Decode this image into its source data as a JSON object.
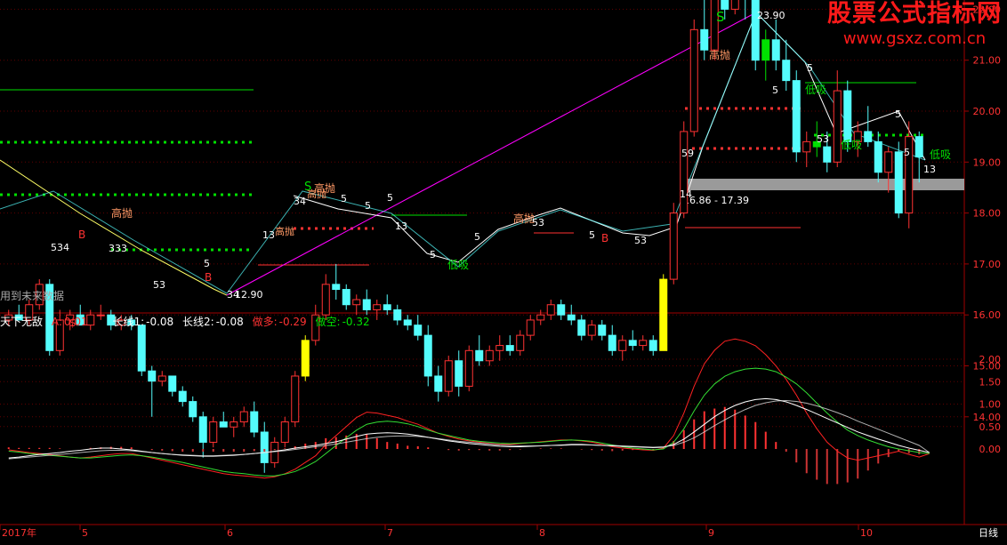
{
  "watermark": {
    "title": "股票公式指标网",
    "url": "www.gsxz.com.cn"
  },
  "colors": {
    "up": "#ff3232",
    "down": "#54fcfc",
    "frame": "#a00000",
    "grid": "#600000",
    "yellow": "#ffff00",
    "green": "#00e000",
    "magenta": "#ff00ff",
    "white": "#ffffff",
    "orange": "#ff9966"
  },
  "main_panel": {
    "note": "用到未来数据",
    "price_range": {
      "high": 23.9,
      "low": 12.9
    },
    "price_labels": {
      "high": "23.90",
      "low": "12.90",
      "box": "16.86 - 17.39"
    },
    "signals": {
      "sell": "S",
      "buy": "B",
      "top": "高抛",
      "bottom": "低吸",
      "warn": "$"
    }
  },
  "indicator": {
    "name": "天下无敌",
    "a_label": "A:",
    "a_value": "0.01",
    "l1_label": "长线1:",
    "l1_value": "-0.08",
    "l2_label": "长线2:",
    "l2_value": "-0.08",
    "long_label": "做多:",
    "long_value": "-0.29",
    "short_label": "做空:",
    "short_value": "-0.32"
  },
  "price_axis": [
    "22.00",
    "21.00",
    "20.00",
    "19.00",
    "18.00",
    "17.00",
    "16.00",
    "15.00",
    "14.00"
  ],
  "indicator_axis": [
    "2.00",
    "1.50",
    "1.00",
    "0.50",
    "0.00"
  ],
  "date_axis": [
    "2017年",
    "5",
    "6",
    "7",
    "8",
    "9",
    "10"
  ],
  "period": "日线",
  "chart_data": {
    "type": "candlestick",
    "candles": [
      [
        15.9,
        16.1,
        15.8,
        16.0
      ],
      [
        16.0,
        16.2,
        15.9,
        15.9
      ],
      [
        15.9,
        16.3,
        15.8,
        16.2
      ],
      [
        16.2,
        16.7,
        16.1,
        16.6
      ],
      [
        16.6,
        16.7,
        15.2,
        15.3
      ],
      [
        15.3,
        16.1,
        15.2,
        15.9
      ],
      [
        15.9,
        16.1,
        15.7,
        16.0
      ],
      [
        16.0,
        16.2,
        15.8,
        15.8
      ],
      [
        15.8,
        16.1,
        15.7,
        16.0
      ],
      [
        16.0,
        16.2,
        15.9,
        16.0
      ],
      [
        16.0,
        16.1,
        15.7,
        15.8
      ],
      [
        15.8,
        16.0,
        15.7,
        15.9
      ],
      [
        15.9,
        16.0,
        15.7,
        15.8
      ],
      [
        15.8,
        15.8,
        14.8,
        14.9
      ],
      [
        14.9,
        15.0,
        14.0,
        14.7
      ],
      [
        14.7,
        14.9,
        14.6,
        14.8
      ],
      [
        14.8,
        14.8,
        14.4,
        14.5
      ],
      [
        14.5,
        14.6,
        14.2,
        14.3
      ],
      [
        14.3,
        14.4,
        13.9,
        14.0
      ],
      [
        14.0,
        14.1,
        13.2,
        13.5
      ],
      [
        13.5,
        14.0,
        13.4,
        13.9
      ],
      [
        13.9,
        14.1,
        13.8,
        13.8
      ],
      [
        13.8,
        14.0,
        13.6,
        13.9
      ],
      [
        13.9,
        14.2,
        13.8,
        14.1
      ],
      [
        14.1,
        14.3,
        13.6,
        13.7
      ],
      [
        13.7,
        13.9,
        12.9,
        13.1
      ],
      [
        13.1,
        13.6,
        13.0,
        13.5
      ],
      [
        13.5,
        14.0,
        13.4,
        13.9
      ],
      [
        13.9,
        14.9,
        13.8,
        14.8
      ],
      [
        14.8,
        15.6,
        14.7,
        15.5
      ],
      [
        15.5,
        16.2,
        15.4,
        16.0
      ],
      [
        16.0,
        16.8,
        15.9,
        16.6
      ],
      [
        16.6,
        17.0,
        16.3,
        16.5
      ],
      [
        16.5,
        16.6,
        16.1,
        16.2
      ],
      [
        16.2,
        16.4,
        16.0,
        16.3
      ],
      [
        16.3,
        16.5,
        16.0,
        16.1
      ],
      [
        16.1,
        16.3,
        15.9,
        16.2
      ],
      [
        16.2,
        16.4,
        16.0,
        16.1
      ],
      [
        16.1,
        16.2,
        15.8,
        15.9
      ],
      [
        15.9,
        16.0,
        15.7,
        15.8
      ],
      [
        15.8,
        16.0,
        15.5,
        15.6
      ],
      [
        15.6,
        15.8,
        14.6,
        14.8
      ],
      [
        14.8,
        15.0,
        14.3,
        14.5
      ],
      [
        14.5,
        15.2,
        14.4,
        15.1
      ],
      [
        15.1,
        15.3,
        14.4,
        14.6
      ],
      [
        14.6,
        15.4,
        14.5,
        15.3
      ],
      [
        15.3,
        15.6,
        15.0,
        15.1
      ],
      [
        15.1,
        15.4,
        15.0,
        15.3
      ],
      [
        15.3,
        15.6,
        15.1,
        15.4
      ],
      [
        15.4,
        15.6,
        15.2,
        15.3
      ],
      [
        15.3,
        15.7,
        15.2,
        15.6
      ],
      [
        15.6,
        16.0,
        15.5,
        15.9
      ],
      [
        15.9,
        16.1,
        15.8,
        16.0
      ],
      [
        16.0,
        16.3,
        15.9,
        16.2
      ],
      [
        16.2,
        16.3,
        15.9,
        16.0
      ],
      [
        16.0,
        16.2,
        15.8,
        15.9
      ],
      [
        15.9,
        16.0,
        15.5,
        15.6
      ],
      [
        15.6,
        15.9,
        15.5,
        15.8
      ],
      [
        15.8,
        15.9,
        15.5,
        15.6
      ],
      [
        15.6,
        15.8,
        15.2,
        15.3
      ],
      [
        15.3,
        15.6,
        15.1,
        15.5
      ],
      [
        15.5,
        15.7,
        15.3,
        15.4
      ],
      [
        15.4,
        15.6,
        15.3,
        15.5
      ],
      [
        15.5,
        15.6,
        15.2,
        15.3
      ],
      [
        15.3,
        16.8,
        15.3,
        16.7
      ],
      [
        16.7,
        18.2,
        16.6,
        18.0
      ],
      [
        18.0,
        19.8,
        17.9,
        19.6
      ],
      [
        19.6,
        21.8,
        19.5,
        21.6
      ],
      [
        21.6,
        22.3,
        21.0,
        21.2
      ],
      [
        21.2,
        22.6,
        21.0,
        22.4
      ],
      [
        22.4,
        23.4,
        21.8,
        22.0
      ],
      [
        22.0,
        23.9,
        21.9,
        23.2
      ],
      [
        23.2,
        23.5,
        21.8,
        22.2
      ],
      [
        22.2,
        22.5,
        20.8,
        21.0
      ],
      [
        21.0,
        21.6,
        20.6,
        21.4
      ],
      [
        21.4,
        21.8,
        20.8,
        21.0
      ],
      [
        21.0,
        21.4,
        20.4,
        20.6
      ],
      [
        20.6,
        20.8,
        19.0,
        19.2
      ],
      [
        19.2,
        19.6,
        18.9,
        19.4
      ],
      [
        19.4,
        19.8,
        19.1,
        19.3
      ],
      [
        19.3,
        19.6,
        18.8,
        19.0
      ],
      [
        19.0,
        20.8,
        18.9,
        20.4
      ],
      [
        20.4,
        20.6,
        19.2,
        19.4
      ],
      [
        19.4,
        19.8,
        19.1,
        19.6
      ],
      [
        19.6,
        20.1,
        19.3,
        19.4
      ],
      [
        19.4,
        19.6,
        18.6,
        18.8
      ],
      [
        18.8,
        19.3,
        18.4,
        19.2
      ],
      [
        19.2,
        19.4,
        17.9,
        18.0
      ],
      [
        18.0,
        19.8,
        17.7,
        19.5
      ],
      [
        19.5,
        19.6,
        18.6,
        19.1
      ]
    ],
    "indicator": {
      "long": [
        -0.02,
        -0.05,
        -0.08,
        -0.1,
        -0.12,
        -0.15,
        -0.18,
        -0.2,
        -0.18,
        -0.15,
        -0.12,
        -0.1,
        -0.1,
        -0.15,
        -0.2,
        -0.25,
        -0.3,
        -0.35,
        -0.4,
        -0.45,
        -0.5,
        -0.55,
        -0.58,
        -0.6,
        -0.62,
        -0.65,
        -0.62,
        -0.55,
        -0.45,
        -0.3,
        -0.15,
        0.1,
        0.3,
        0.5,
        0.7,
        0.82,
        0.8,
        0.75,
        0.7,
        0.62,
        0.55,
        0.45,
        0.35,
        0.28,
        0.22,
        0.18,
        0.15,
        0.12,
        0.1,
        0.1,
        0.12,
        0.14,
        0.16,
        0.18,
        0.2,
        0.2,
        0.18,
        0.15,
        0.1,
        0.05,
        0.02,
        0.0,
        -0.02,
        -0.03,
        0.02,
        0.3,
        0.8,
        1.4,
        1.9,
        2.2,
        2.4,
        2.45,
        2.4,
        2.3,
        2.1,
        1.85,
        1.55,
        1.2,
        0.8,
        0.45,
        0.15,
        -0.05,
        -0.2,
        -0.25,
        -0.2,
        -0.15,
        -0.1,
        -0.05,
        -0.12,
        -0.18,
        -0.1
      ],
      "short": [
        -0.05,
        -0.07,
        -0.1,
        -0.12,
        -0.14,
        -0.16,
        -0.18,
        -0.2,
        -0.2,
        -0.18,
        -0.16,
        -0.14,
        -0.13,
        -0.15,
        -0.18,
        -0.22,
        -0.26,
        -0.3,
        -0.35,
        -0.4,
        -0.45,
        -0.5,
        -0.53,
        -0.55,
        -0.58,
        -0.6,
        -0.6,
        -0.56,
        -0.5,
        -0.4,
        -0.28,
        -0.1,
        0.08,
        0.25,
        0.42,
        0.55,
        0.6,
        0.62,
        0.6,
        0.56,
        0.5,
        0.42,
        0.35,
        0.3,
        0.25,
        0.2,
        0.17,
        0.15,
        0.13,
        0.12,
        0.13,
        0.14,
        0.15,
        0.17,
        0.19,
        0.2,
        0.19,
        0.17,
        0.13,
        0.09,
        0.05,
        0.02,
        0.0,
        -0.02,
        0.0,
        0.15,
        0.45,
        0.85,
        1.2,
        1.45,
        1.62,
        1.72,
        1.78,
        1.8,
        1.78,
        1.72,
        1.6,
        1.45,
        1.25,
        1.02,
        0.8,
        0.6,
        0.42,
        0.3,
        0.2,
        0.12,
        0.05,
        0.0,
        -0.04,
        -0.08,
        -0.1
      ],
      "line1": [
        -0.2,
        -0.18,
        -0.15,
        -0.12,
        -0.1,
        -0.08,
        -0.05,
        -0.03,
        0.0,
        0.02,
        0.02,
        0.0,
        -0.02,
        -0.05,
        -0.08,
        -0.1,
        -0.12,
        -0.14,
        -0.15,
        -0.16,
        -0.16,
        -0.15,
        -0.14,
        -0.12,
        -0.1,
        -0.08,
        -0.05,
        -0.02,
        0.02,
        0.05,
        0.08,
        0.12,
        0.16,
        0.22,
        0.28,
        0.33,
        0.35,
        0.36,
        0.35,
        0.33,
        0.3,
        0.26,
        0.22,
        0.18,
        0.15,
        0.12,
        0.1,
        0.08,
        0.06,
        0.05,
        0.05,
        0.06,
        0.07,
        0.08,
        0.09,
        0.1,
        0.1,
        0.09,
        0.08,
        0.07,
        0.06,
        0.05,
        0.04,
        0.03,
        0.04,
        0.1,
        0.22,
        0.38,
        0.55,
        0.72,
        0.86,
        0.97,
        1.05,
        1.1,
        1.12,
        1.1,
        1.05,
        0.97,
        0.88,
        0.78,
        0.68,
        0.58,
        0.48,
        0.38,
        0.3,
        0.22,
        0.15,
        0.08,
        0.02,
        -0.03,
        -0.08
      ],
      "line2": [
        -0.22,
        -0.2,
        -0.18,
        -0.16,
        -0.14,
        -0.12,
        -0.1,
        -0.08,
        -0.06,
        -0.04,
        -0.03,
        -0.03,
        -0.04,
        -0.06,
        -0.08,
        -0.1,
        -0.12,
        -0.13,
        -0.14,
        -0.15,
        -0.15,
        -0.14,
        -0.13,
        -0.12,
        -0.1,
        -0.08,
        -0.06,
        -0.04,
        -0.01,
        0.02,
        0.05,
        0.08,
        0.11,
        0.15,
        0.19,
        0.23,
        0.26,
        0.28,
        0.29,
        0.29,
        0.28,
        0.26,
        0.23,
        0.2,
        0.17,
        0.15,
        0.13,
        0.11,
        0.09,
        0.08,
        0.07,
        0.07,
        0.07,
        0.08,
        0.08,
        0.09,
        0.09,
        0.09,
        0.08,
        0.08,
        0.07,
        0.06,
        0.05,
        0.04,
        0.05,
        0.08,
        0.15,
        0.25,
        0.38,
        0.52,
        0.65,
        0.77,
        0.88,
        0.97,
        1.03,
        1.07,
        1.08,
        1.06,
        1.02,
        0.96,
        0.89,
        0.81,
        0.72,
        0.62,
        0.53,
        0.44,
        0.35,
        0.26,
        0.17,
        0.08,
        -0.08
      ]
    }
  }
}
